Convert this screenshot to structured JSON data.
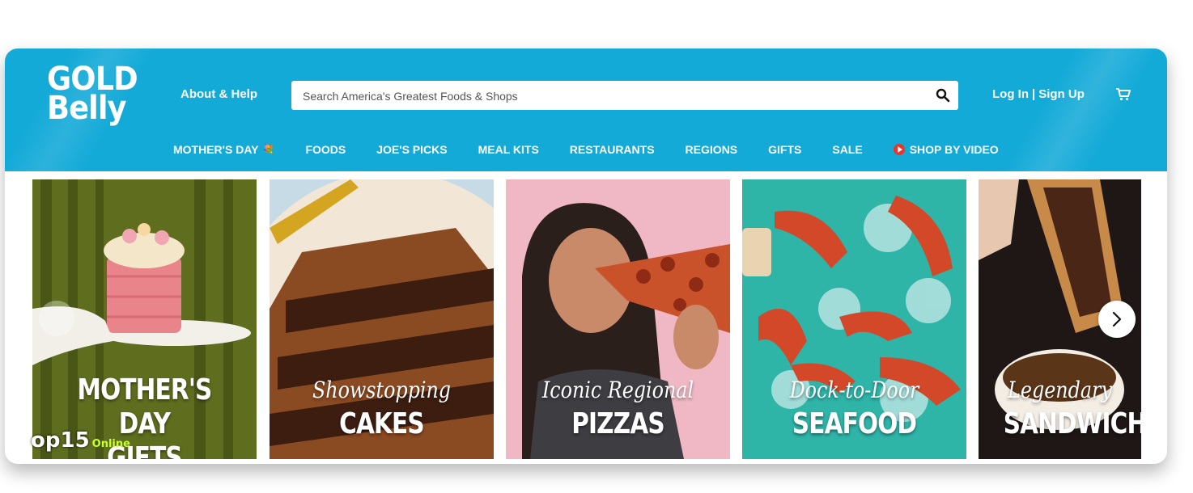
{
  "brand": {
    "logo_line1": "GOLD",
    "logo_line2": "Belly"
  },
  "header": {
    "about_label": "About & Help",
    "search_placeholder": "Search America's Greatest Foods & Shops",
    "login_label": "Log In",
    "signup_label": "Sign Up",
    "separator": "|"
  },
  "nav": {
    "items": [
      {
        "label": "MOTHER'S DAY",
        "icon": "flower-icon"
      },
      {
        "label": "FOODS"
      },
      {
        "label": "JOE'S PICKS"
      },
      {
        "label": "MEAL KITS"
      },
      {
        "label": "RESTAURANTS"
      },
      {
        "label": "REGIONS"
      },
      {
        "label": "GIFTS"
      },
      {
        "label": "SALE"
      },
      {
        "label": "SHOP BY VIDEO",
        "icon": "play-icon"
      }
    ]
  },
  "carousel": {
    "cards": [
      {
        "script": "",
        "line1": "MOTHER'S DAY",
        "line2": "GIFTS"
      },
      {
        "script": "Showstopping",
        "line1": "CAKES"
      },
      {
        "script": "Iconic Regional",
        "line1": "PIZZAS"
      },
      {
        "script": "Dock-to-Door",
        "line1": "SEAFOOD"
      },
      {
        "script": "Legendary",
        "line1": "SANDWICH"
      }
    ]
  },
  "watermark": {
    "text": "op15",
    "sub": "Online"
  },
  "colors": {
    "brand_blue": "#14aad8",
    "accent_red": "#e8362c"
  }
}
